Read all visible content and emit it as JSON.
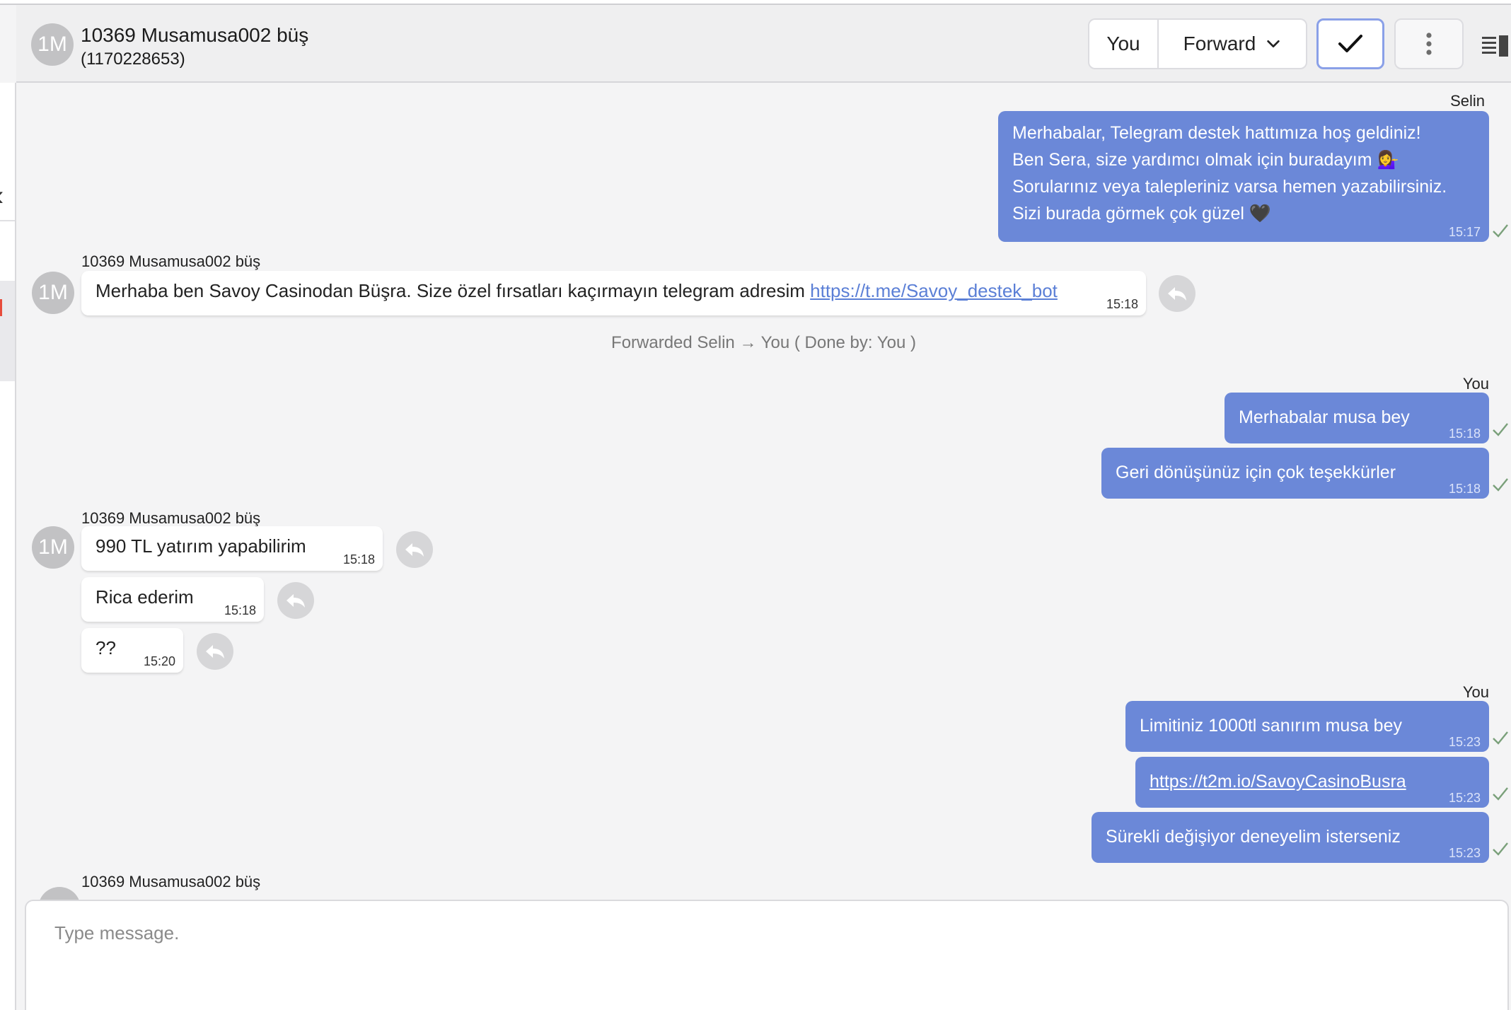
{
  "header": {
    "avatar_initials": "1M",
    "name": "10369 Musamusa002 büş",
    "id": "(1170228653)",
    "assignee_label": "You",
    "forward_label": "Forward"
  },
  "messages": {
    "m1": {
      "sender": "Selin",
      "lines": [
        "Merhabalar, Telegram destek hattımıza hoş geldiniz!",
        "Ben Sera, size yardımcı olmak için buradayım 💁‍♀️",
        "Sorularınız veya talepleriniz varsa hemen yazabilirsiniz.",
        "Sizi burada görmek çok güzel 🖤"
      ],
      "time": "15:17"
    },
    "m2": {
      "sender": "10369 Musamusa002 büş",
      "avatar": "1M",
      "text": "Merhaba ben Savoy Casinodan Büşra. Size özel fırsatları kaçırmayın telegram adresim ",
      "link": "https://t.me/Savoy_destek_bot",
      "time": "15:18"
    },
    "system_note": "Forwarded Selin → You ( Done by: You )",
    "m3": {
      "sender": "You",
      "text": "Merhabalar musa bey",
      "time": "15:18"
    },
    "m4": {
      "text": "Geri dönüşünüz için çok teşekkürler",
      "time": "15:18"
    },
    "m5": {
      "sender": "10369 Musamusa002 büş",
      "avatar": "1M",
      "text": "990 TL yatırım yapabilirim",
      "time": "15:18"
    },
    "m6": {
      "text": "Rica ederim",
      "time": "15:18"
    },
    "m7": {
      "text": "??",
      "time": "15:20"
    },
    "m8": {
      "sender": "You",
      "text": "Limitiniz 1000tl sanırım musa bey",
      "time": "15:23"
    },
    "m9": {
      "link": "https://t2m.io/SavoyCasinoBusra",
      "time": "15:23"
    },
    "m10": {
      "text": "Sürekli değişiyor deneyelim isterseniz",
      "time": "15:23"
    },
    "m11": {
      "sender": "10369 Musamusa002 büş",
      "avatar": "1M"
    }
  },
  "composer": {
    "placeholder": "Type message."
  },
  "colors": {
    "outgoing_bubble": "#6b88d8",
    "reply_button": "#d6d6d8",
    "accent_border": "#8aa0e8",
    "link": "#5b7fd6"
  },
  "icons": [
    "checkmark-icon",
    "more-vertical-icon",
    "panel-toggle-icon",
    "chevron-down-icon",
    "reply-icon",
    "read-tick-icon"
  ]
}
